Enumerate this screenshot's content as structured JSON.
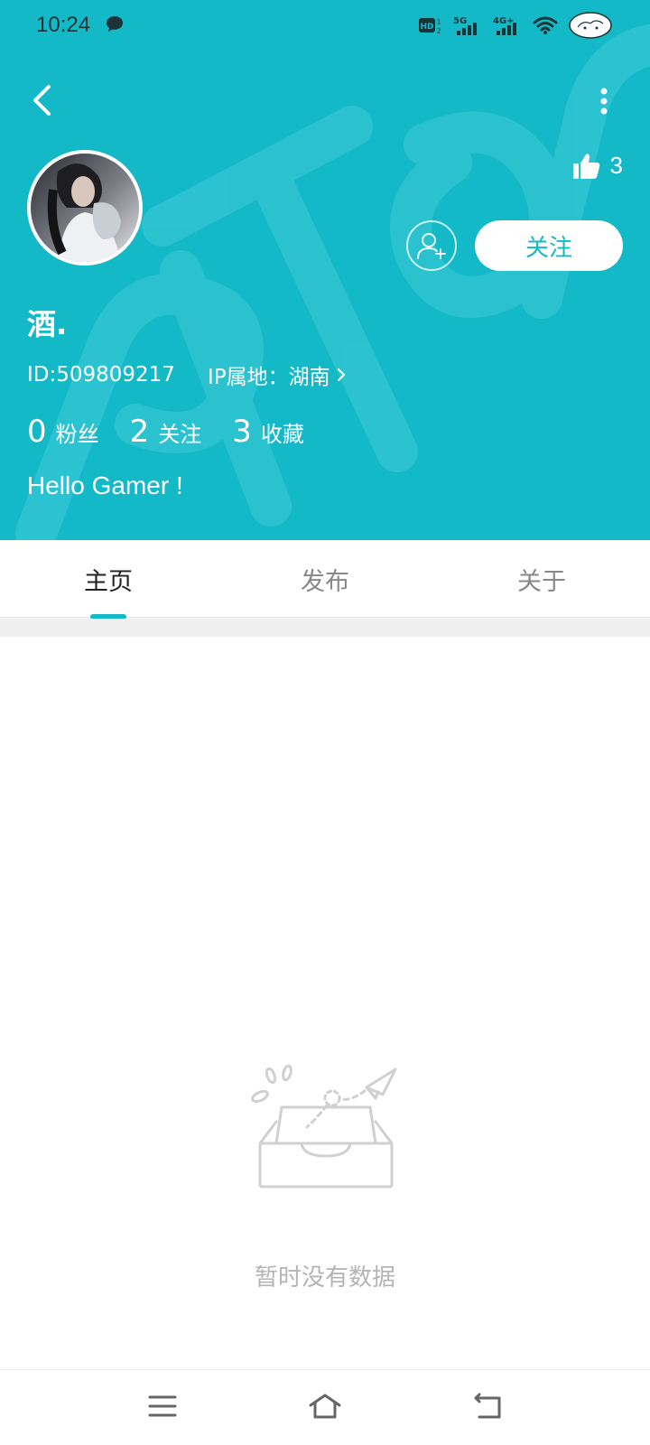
{
  "status_bar": {
    "time": "10:24",
    "hd_label": "HD",
    "network_5g": "5G",
    "network_4g": "4G+"
  },
  "profile": {
    "likes_count": "3",
    "follow_label": "关注",
    "username": "酒.",
    "id_text": "ID:509809217",
    "ip_text": "IP属地：湖南",
    "stats": [
      {
        "value": "0",
        "label": "粉丝"
      },
      {
        "value": "2",
        "label": "关注"
      },
      {
        "value": "3",
        "label": "收藏"
      }
    ],
    "bio": "Hello Gamer !"
  },
  "tabs": [
    {
      "label": "主页",
      "active": true
    },
    {
      "label": "发布",
      "active": false
    },
    {
      "label": "关于",
      "active": false
    }
  ],
  "empty_state": {
    "message": "暂时没有数据"
  },
  "colors": {
    "brand": "#14b9c8",
    "header_bg": "#14b9c8",
    "tab_active": "#222222",
    "tab_inactive": "#888888"
  },
  "icons": {
    "back": "chevron-left-icon",
    "more": "more-vertical-icon",
    "like": "thumbs-up-icon",
    "add_friend": "add-user-icon",
    "ip_arrow": "chevron-right-icon",
    "empty": "empty-inbox-icon",
    "nav_menu": "menu-icon",
    "nav_home": "home-icon",
    "nav_back": "back-icon"
  }
}
